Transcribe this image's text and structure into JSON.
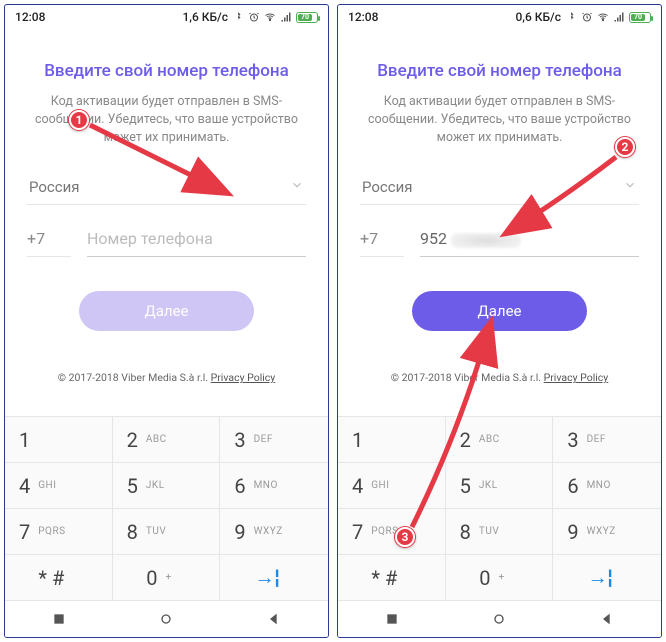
{
  "markers": [
    "1",
    "2",
    "3"
  ],
  "screens": [
    {
      "status": {
        "time": "12:08",
        "net_speed": "1,6 КБ/с",
        "battery": "70"
      },
      "title": "Введите свой номер телефона",
      "desc": "Код активации будет отправлен в SMS-сообщении. Убедитесь, что ваше устройство может их принимать.",
      "country": "Россия",
      "code": "+7",
      "phone_placeholder": "Номер телефона",
      "phone_value": "",
      "next_label": "Далее",
      "next_enabled": false,
      "legal_prefix": "© 2017-2018 Viber Media S.à r.l. ",
      "legal_link": "Privacy Policy"
    },
    {
      "status": {
        "time": "12:08",
        "net_speed": "0,6 КБ/с",
        "battery": "70"
      },
      "title": "Введите свой номер телефона",
      "desc": "Код активации будет отправлен в SMS-сообщении. Убедитесь, что ваше устройство может их принимать.",
      "country": "Россия",
      "code": "+7",
      "phone_placeholder": "Номер телефона",
      "phone_value": "952",
      "next_label": "Далее",
      "next_enabled": true,
      "legal_prefix": "© 2017-2018 Viber Media S.à r.l. ",
      "legal_link": "Privacy Policy"
    }
  ],
  "keypad": [
    {
      "d": "1",
      "s": ""
    },
    {
      "d": "2",
      "s": "ABC"
    },
    {
      "d": "3",
      "s": "DEF"
    },
    {
      "d": "4",
      "s": "GHI"
    },
    {
      "d": "5",
      "s": "JKL"
    },
    {
      "d": "6",
      "s": "MNO"
    },
    {
      "d": "7",
      "s": "PQRS"
    },
    {
      "d": "8",
      "s": "TUV"
    },
    {
      "d": "9",
      "s": "WXYZ"
    },
    {
      "d": "* #",
      "s": ""
    },
    {
      "d": "0",
      "s": "+"
    },
    {
      "d": "go",
      "s": ""
    }
  ]
}
